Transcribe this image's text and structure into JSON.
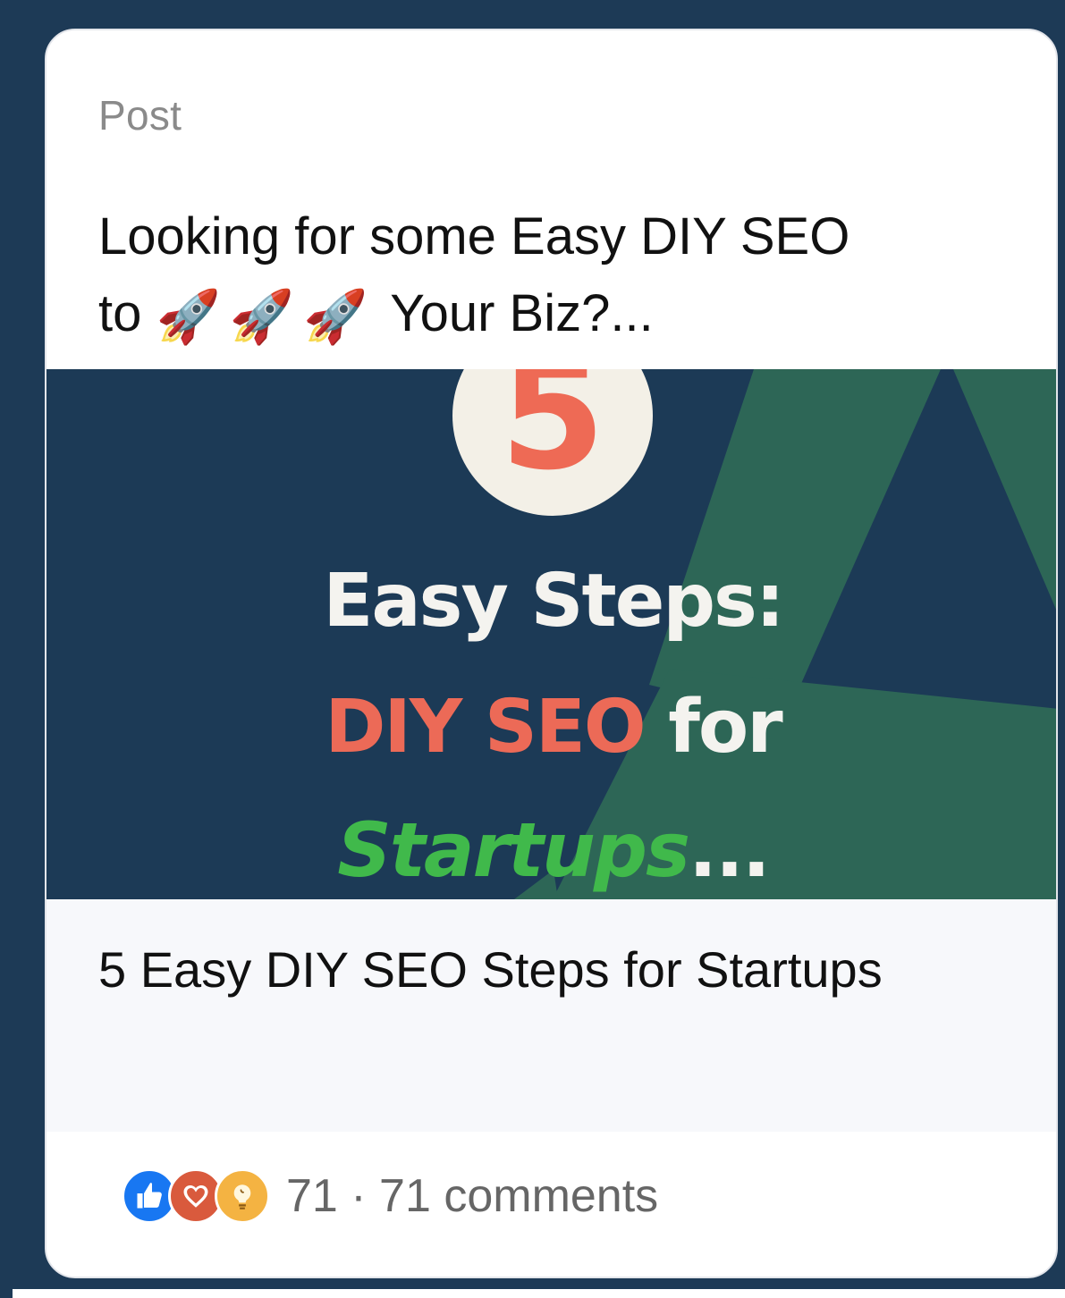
{
  "card": {
    "type_label": "Post",
    "post_text_line_1": "Looking for some Easy DIY SEO",
    "post_text_prefix": "to",
    "post_text_suffix": "Your Biz?...",
    "rocket_emoji": "🚀",
    "hero": {
      "number": "5",
      "line_1": "Easy Steps:",
      "line_2_red": "DIY SEO",
      "line_2_light": " for",
      "line_3_green": "Startups",
      "line_3_light": "..."
    },
    "link_title": "5 Easy DIY SEO Steps for Startups",
    "reactions": {
      "icons": [
        "like-icon",
        "love-icon",
        "insight-icon"
      ],
      "summary": "71 · 71 comments"
    }
  },
  "colors": {
    "page_background": "#1d3a56",
    "hero_background": "#1c3a56",
    "accent_red": "#ec6a57",
    "accent_green": "#40b94b",
    "accent_light": "#f4f3ef"
  }
}
